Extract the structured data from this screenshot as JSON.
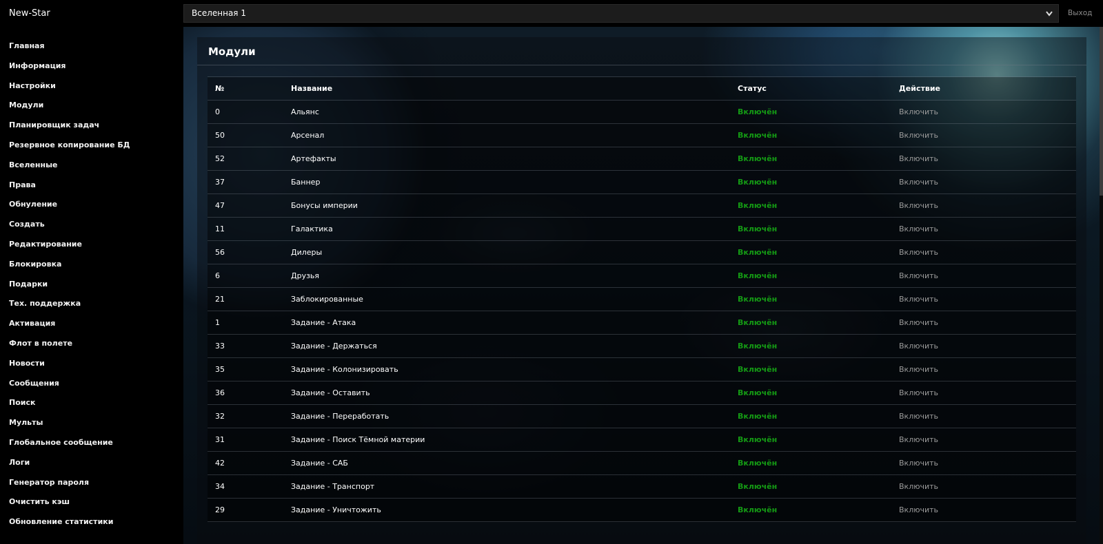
{
  "app": {
    "brand": "New-Star"
  },
  "sidebar": {
    "items": [
      "Главная",
      "Информация",
      "Настройки",
      "Модули",
      "Планировщик задач",
      "Резервное копирование БД",
      "Вселенные",
      "Права",
      "Обнуление",
      "Создать",
      "Редактирование",
      "Блокировка",
      "Подарки",
      "Тех. поддержка",
      "Активация",
      "Флот в полете",
      "Новости",
      "Сообщения",
      "Поиск",
      "Мульты",
      "Глобальное сообщение",
      "Логи",
      "Генератор пароля",
      "Очистить кэш",
      "Обновление статистики"
    ]
  },
  "topbar": {
    "universe_selected": "Вселенная 1",
    "select_icon": "chevron-down-icon",
    "logout_label": "Выход"
  },
  "panel": {
    "title": "Модули"
  },
  "table": {
    "headers": {
      "id": "№",
      "name": "Название",
      "status": "Статус",
      "action": "Действие"
    },
    "rows": [
      {
        "id": "0",
        "name": "Альянс",
        "status": "Включён",
        "action": "Включить"
      },
      {
        "id": "50",
        "name": "Арсенал",
        "status": "Включён",
        "action": "Включить"
      },
      {
        "id": "52",
        "name": "Артефакты",
        "status": "Включён",
        "action": "Включить"
      },
      {
        "id": "37",
        "name": "Баннер",
        "status": "Включён",
        "action": "Включить"
      },
      {
        "id": "47",
        "name": "Бонусы империи",
        "status": "Включён",
        "action": "Включить"
      },
      {
        "id": "11",
        "name": "Галактика",
        "status": "Включён",
        "action": "Включить"
      },
      {
        "id": "56",
        "name": "Дилеры",
        "status": "Включён",
        "action": "Включить"
      },
      {
        "id": "6",
        "name": "Друзья",
        "status": "Включён",
        "action": "Включить"
      },
      {
        "id": "21",
        "name": "Заблокированные",
        "status": "Включён",
        "action": "Включить"
      },
      {
        "id": "1",
        "name": "Задание - Атака",
        "status": "Включён",
        "action": "Включить"
      },
      {
        "id": "33",
        "name": "Задание - Держаться",
        "status": "Включён",
        "action": "Включить"
      },
      {
        "id": "35",
        "name": "Задание - Колонизировать",
        "status": "Включён",
        "action": "Включить"
      },
      {
        "id": "36",
        "name": "Задание - Оставить",
        "status": "Включён",
        "action": "Включить"
      },
      {
        "id": "32",
        "name": "Задание - Переработать",
        "status": "Включён",
        "action": "Включить"
      },
      {
        "id": "31",
        "name": "Задание - Поиск Тёмной материи",
        "status": "Включён",
        "action": "Включить"
      },
      {
        "id": "42",
        "name": "Задание - САБ",
        "status": "Включён",
        "action": "Включить"
      },
      {
        "id": "34",
        "name": "Задание - Транспорт",
        "status": "Включён",
        "action": "Включить"
      },
      {
        "id": "29",
        "name": "Задание - Уничтожить",
        "status": "Включён",
        "action": "Включить"
      }
    ]
  },
  "colors": {
    "status_enabled": "#149a14",
    "action_link": "#9a9a9a",
    "sidebar_bg": "#000000"
  }
}
